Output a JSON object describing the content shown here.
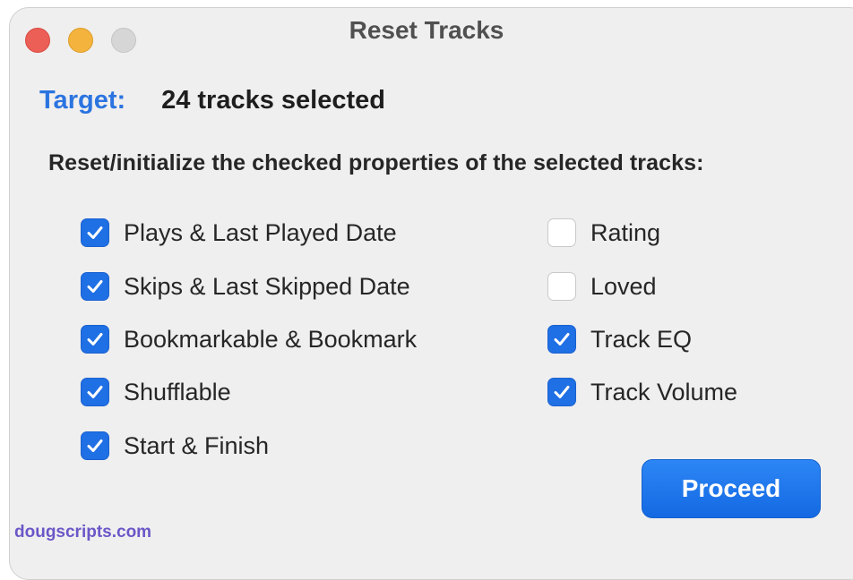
{
  "window": {
    "title": "Reset Tracks"
  },
  "target": {
    "label": "Target:",
    "value": "24 tracks selected"
  },
  "instruction": "Reset/initialize the checked properties of the selected tracks:",
  "options_left": [
    {
      "label": "Plays & Last Played Date",
      "checked": true
    },
    {
      "label": "Skips & Last Skipped Date",
      "checked": true
    },
    {
      "label": "Bookmarkable & Bookmark",
      "checked": true
    },
    {
      "label": "Shufflable",
      "checked": true
    },
    {
      "label": "Start & Finish",
      "checked": true
    }
  ],
  "options_right": [
    {
      "label": "Rating",
      "checked": false
    },
    {
      "label": "Loved",
      "checked": false
    },
    {
      "label": "Track EQ",
      "checked": true
    },
    {
      "label": "Track Volume",
      "checked": true
    }
  ],
  "proceed_button": "Proceed",
  "footer_link": "dougscripts.com",
  "colors": {
    "accent": "#1f6fe5",
    "target_label": "#2b74e0",
    "link": "#6a57c8"
  }
}
